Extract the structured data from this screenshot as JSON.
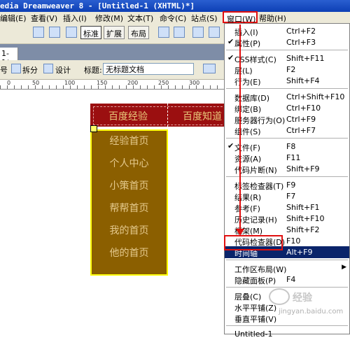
{
  "titlebar": {
    "text": "edia Dreamweaver 8 - [Untitled-1 (XHTML)*]"
  },
  "menubar": {
    "items": [
      "编辑(E)",
      "查看(V)",
      "插入(I)",
      "修改(M)",
      "文本(T)",
      "命令(C)",
      "站点(S)",
      "窗口(W)",
      "帮助(H)"
    ]
  },
  "toolbar1": {
    "standard": "标准",
    "expanded": "扩展",
    "layout": "布局"
  },
  "doc_tab": {
    "label": "1-1*"
  },
  "toolbar2": {
    "partial": "号",
    "split": "拆分",
    "design": "设计",
    "title_label": "标题:",
    "title_value": "无标题文档"
  },
  "ruler": {
    "ticks": [
      "0",
      "50",
      "100",
      "150",
      "200",
      "250",
      "300"
    ]
  },
  "page": {
    "nav_top": [
      "百度经验",
      "百度知道"
    ],
    "sub_items": [
      "经验首页",
      "个人中心",
      "小策首页",
      "帮帮首页",
      "我的首页",
      "他的首页"
    ]
  },
  "window_menu": {
    "items": [
      {
        "check": "",
        "label": "插入(I)",
        "shortcut": "Ctrl+F2"
      },
      {
        "check": "✔",
        "label": "属性(P)",
        "shortcut": "Ctrl+F3"
      },
      {
        "sep": true
      },
      {
        "check": "✔",
        "label": "CSS样式(C)",
        "shortcut": "Shift+F11"
      },
      {
        "check": "",
        "label": "层(L)",
        "shortcut": "F2"
      },
      {
        "check": "",
        "label": "行为(E)",
        "shortcut": "Shift+F4"
      },
      {
        "sep": true
      },
      {
        "check": "",
        "label": "数据库(D)",
        "shortcut": "Ctrl+Shift+F10"
      },
      {
        "check": "",
        "label": "绑定(B)",
        "shortcut": "Ctrl+F10"
      },
      {
        "check": "",
        "label": "服务器行为(O)",
        "shortcut": "Ctrl+F9"
      },
      {
        "check": "",
        "label": "组件(S)",
        "shortcut": "Ctrl+F7"
      },
      {
        "sep": true
      },
      {
        "check": "✔",
        "label": "文件(F)",
        "shortcut": "F8"
      },
      {
        "check": "",
        "label": "资源(A)",
        "shortcut": "F11"
      },
      {
        "check": "",
        "label": "代码片断(N)",
        "shortcut": "Shift+F9"
      },
      {
        "sep": true
      },
      {
        "check": "",
        "label": "标签检查器(T)",
        "shortcut": "F9"
      },
      {
        "check": "",
        "label": "结果(R)",
        "shortcut": "F7"
      },
      {
        "check": "",
        "label": "参考(F)",
        "shortcut": "Shift+F1"
      },
      {
        "check": "",
        "label": "历史记录(H)",
        "shortcut": "Shift+F10"
      },
      {
        "check": "",
        "label": "框架(M)",
        "shortcut": "Shift+F2"
      },
      {
        "check": "",
        "label": "代码检查器(D)",
        "shortcut": "F10"
      },
      {
        "check": "",
        "label": "时间轴",
        "shortcut": "Alt+F9",
        "highlight": true
      },
      {
        "sep": true
      },
      {
        "check": "",
        "label": "工作区布局(W)",
        "shortcut": "",
        "submenu": true
      },
      {
        "check": "",
        "label": "隐藏面板(P)",
        "shortcut": "F4"
      },
      {
        "sep": true
      },
      {
        "check": "",
        "label": "层叠(C)",
        "shortcut": ""
      },
      {
        "check": "",
        "label": "水平平铺(Z)",
        "shortcut": ""
      },
      {
        "check": "",
        "label": "垂直平铺(V)",
        "shortcut": ""
      },
      {
        "sep": true
      },
      {
        "check": "",
        "label": "Untitled-1",
        "shortcut": ""
      }
    ]
  },
  "watermark": {
    "text": "经验",
    "url": "jingyan.baidu.com"
  },
  "colors": {
    "nav_bg": "#9b0f10",
    "sub_bg": "#8b5f00",
    "highlight": "#0a246a",
    "annotation": "#e01010"
  }
}
